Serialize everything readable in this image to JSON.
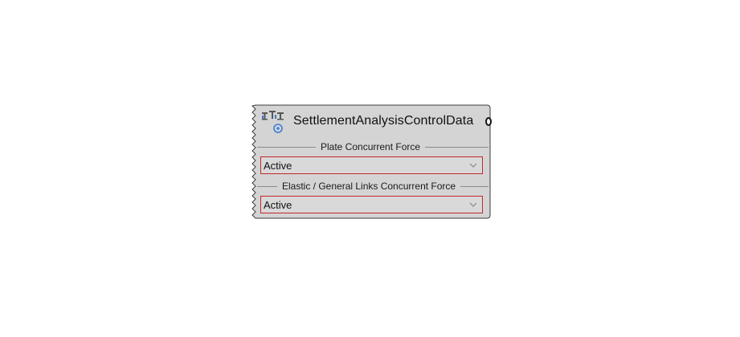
{
  "node": {
    "title": "SettlementAnalysisControlData",
    "icon": "settlement-analysis-icon",
    "output_grip": "output-grip-icon"
  },
  "sections": [
    {
      "label": "Plate Concurrent Force",
      "selected": "Active"
    },
    {
      "label": "Elastic / General Links Concurrent Force",
      "selected": "Active"
    }
  ],
  "colors": {
    "node_fill": "#d4d4d4",
    "node_border": "#3c3c3c",
    "dropdown_border": "#c42828",
    "icon_accent": "#3d7fd6"
  }
}
